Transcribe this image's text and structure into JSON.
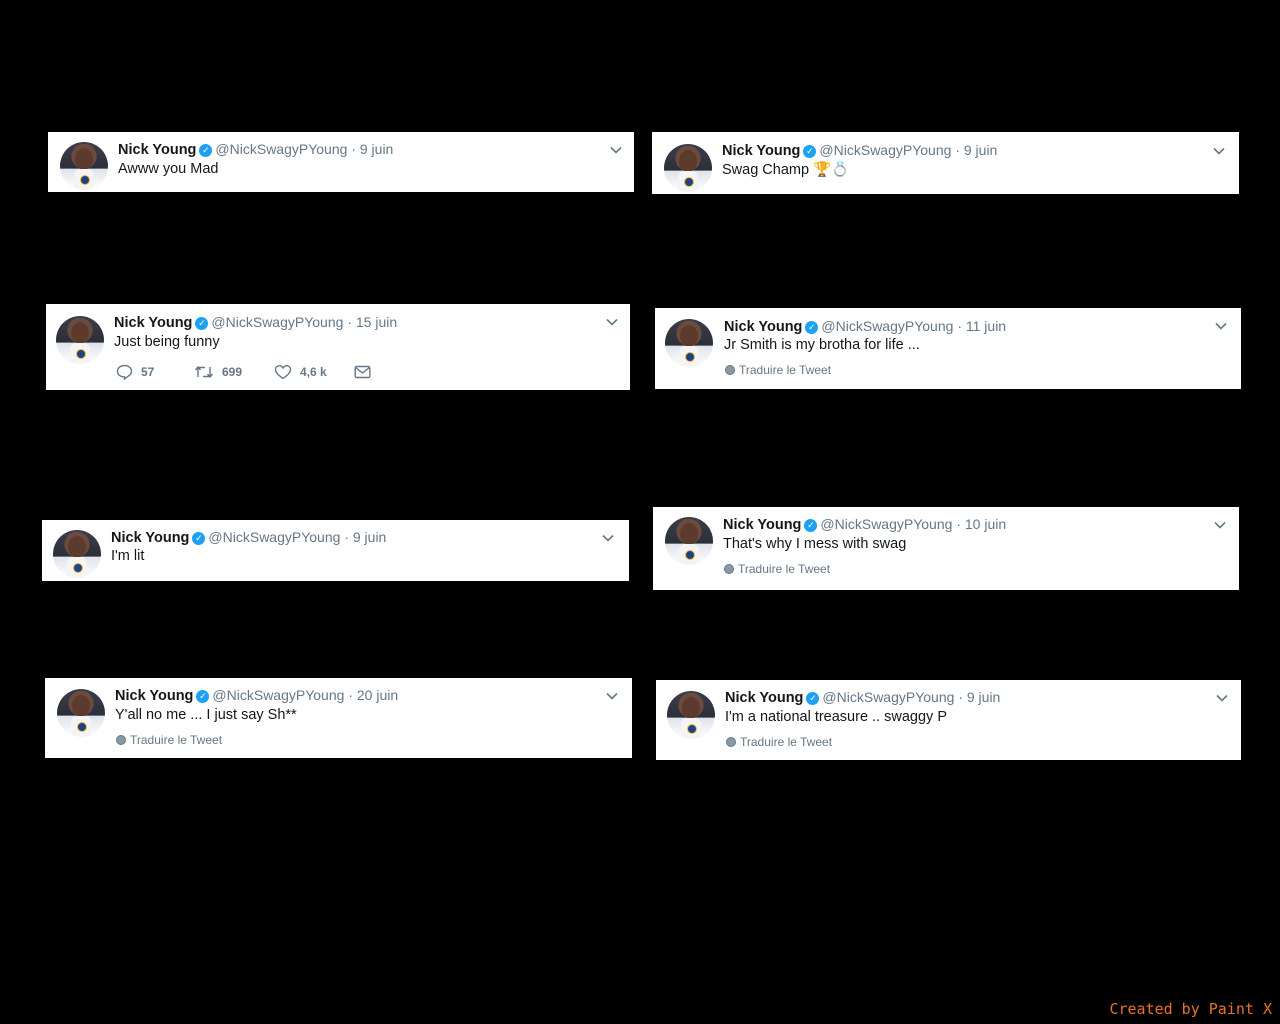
{
  "author": {
    "name": "Nick Young",
    "handle": "@NickSwagyPYoung",
    "separator": "·"
  },
  "translate_label": "Traduire le Tweet",
  "tweets": [
    {
      "date": "9 juin",
      "text": "Awww you Mad"
    },
    {
      "date": "9 juin",
      "text": "Swag Champ 🏆💍"
    },
    {
      "date": "15 juin",
      "text": "Just being funny",
      "replies": "57",
      "retweets": "699",
      "likes": "4,6 k"
    },
    {
      "date": "11 juin",
      "text": "Jr Smith is my brotha for life ..."
    },
    {
      "date": "9 juin",
      "text": "I'm lit"
    },
    {
      "date": "10 juin",
      "text": "That's why I mess with swag"
    },
    {
      "date": "20 juin",
      "text": "Y'all no me ... I just say Sh**"
    },
    {
      "date": "9 juin",
      "text": "I'm a national treasure .. swaggy P"
    }
  ],
  "footer": {
    "credit": "Created by Paint X",
    "credit_color": "#e8722a"
  },
  "colors": {
    "background": "#000000",
    "verified_badge": "#1da1f2",
    "secondary_text": "#657786",
    "primary_text": "#14171a"
  },
  "icons": {
    "verified": "verified-badge-icon",
    "menu": "chevron-down-icon",
    "translate": "globe-icon",
    "reply": "reply-icon",
    "retweet": "retweet-icon",
    "like": "heart-icon",
    "message": "envelope-icon"
  }
}
